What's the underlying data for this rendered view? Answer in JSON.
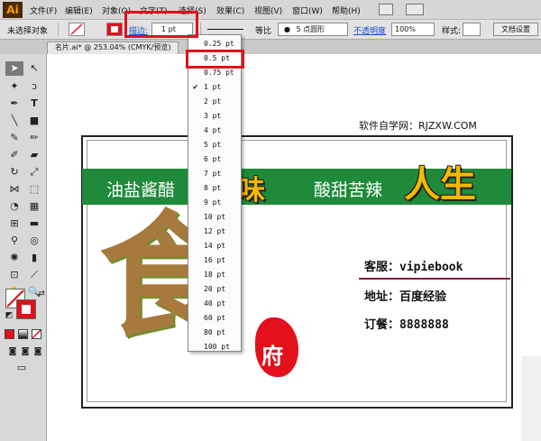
{
  "app": {
    "logo": "Ai"
  },
  "menu": {
    "items": [
      "文件(F)",
      "编辑(E)",
      "对象(O)",
      "文字(T)",
      "选择(S)",
      "效果(C)",
      "视图(V)",
      "窗口(W)",
      "帮助(H)"
    ]
  },
  "control": {
    "no_selection": "未选择对象",
    "stroke_label": "描边:",
    "stroke_value": "1 pt",
    "profile_label": "等比",
    "brush_label": "5 点圆形",
    "opacity_label": "不透明度",
    "opacity_value": "100%",
    "style_label": "样式:",
    "doc_setup": "文档设置"
  },
  "document": {
    "tab_title": "名片.ai* @ 253.04% (CMYK/预览)"
  },
  "stroke_dropdown": {
    "options": [
      "0.25 pt",
      "0.5 pt",
      "0.75 pt",
      "1 pt",
      "2 pt",
      "3 pt",
      "4 pt",
      "5 pt",
      "6 pt",
      "7 pt",
      "8 pt",
      "9 pt",
      "10 pt",
      "12 pt",
      "14 pt",
      "16 pt",
      "18 pt",
      "20 pt",
      "40 pt",
      "60 pt",
      "80 pt",
      "100 pt"
    ],
    "checked": "1 pt",
    "highlighted": "0.5 pt"
  },
  "artwork": {
    "watermark": "软件自学网：RJZXW.COM",
    "band_left": "油盐酱醋",
    "band_yellow_1": "味",
    "band_mid": "酸甜苦辣",
    "band_yellow_2": "人生",
    "big_char": "食",
    "seal_char": "府",
    "line_service": "客服：vipiebook",
    "line_address": "地址：百度经验",
    "line_order": "订餐：8888888"
  },
  "colors": {
    "band_green": "#1f8a3a",
    "highlight_red": "#e0101a",
    "yellow": "#f5b800"
  }
}
